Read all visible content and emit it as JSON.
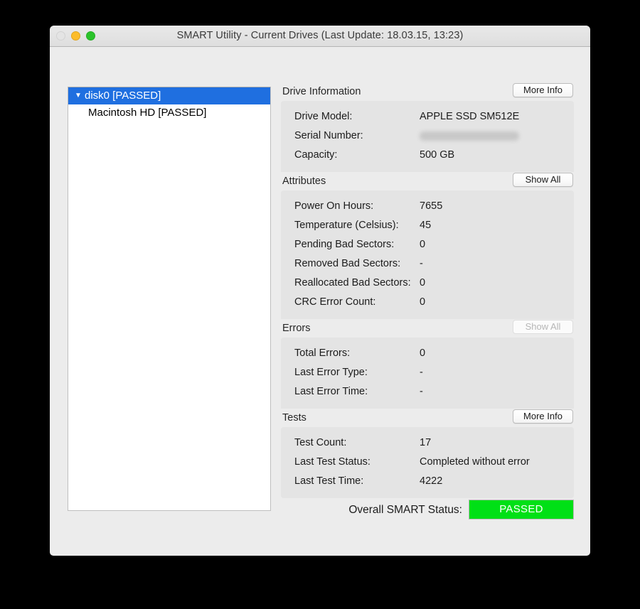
{
  "window": {
    "title": "SMART Utility - Current Drives (Last Update: 18.03.15, 13:23)",
    "traffic_lights": {
      "close": "close-button",
      "minimize": "minimize-button",
      "zoom": "zoom-button"
    }
  },
  "drive_list": {
    "items": [
      {
        "name": "disk0  [PASSED]",
        "selected": true,
        "disclosure": "▼",
        "child": false
      },
      {
        "name": "Macintosh HD  [PASSED]",
        "selected": false,
        "disclosure": "",
        "child": true
      }
    ]
  },
  "sections": [
    {
      "title": "Drive Information",
      "button": {
        "label": "More Info",
        "disabled": false
      },
      "rows": [
        {
          "label": "Drive Model:",
          "value": "APPLE SSD SM512E",
          "redacted": false
        },
        {
          "label": "Serial Number:",
          "value": "",
          "redacted": true
        },
        {
          "label": "Capacity:",
          "value": "500 GB",
          "redacted": false
        }
      ]
    },
    {
      "title": "Attributes",
      "button": {
        "label": "Show All",
        "disabled": false
      },
      "rows": [
        {
          "label": "Power On Hours:",
          "value": "7655",
          "redacted": false
        },
        {
          "label": "Temperature (Celsius):",
          "value": "45",
          "redacted": false
        },
        {
          "label": "Pending Bad Sectors:",
          "value": "0",
          "redacted": false
        },
        {
          "label": "Removed Bad Sectors:",
          "value": "-",
          "redacted": false
        },
        {
          "label": "Reallocated Bad Sectors:",
          "value": "0",
          "redacted": false
        },
        {
          "label": "CRC Error Count:",
          "value": "0",
          "redacted": false
        }
      ]
    },
    {
      "title": "Errors",
      "button": {
        "label": "Show All",
        "disabled": true
      },
      "rows": [
        {
          "label": "Total Errors:",
          "value": "0",
          "redacted": false
        },
        {
          "label": "Last Error Type:",
          "value": "-",
          "redacted": false
        },
        {
          "label": "Last Error Time:",
          "value": "-",
          "redacted": false
        }
      ]
    },
    {
      "title": "Tests",
      "button": {
        "label": "More Info",
        "disabled": false
      },
      "rows": [
        {
          "label": "Test Count:",
          "value": "17",
          "redacted": false
        },
        {
          "label": "Last Test Status:",
          "value": "Completed without error",
          "redacted": false
        },
        {
          "label": "Last Test Time:",
          "value": "4222",
          "redacted": false
        }
      ]
    }
  ],
  "footer": {
    "label": "Overall SMART Status:",
    "status": "PASSED",
    "status_color": "#00e016",
    "status_text_color": "#ffffff"
  },
  "colors": {
    "window_background": "#ececec",
    "panel_background": "#e4e4e4",
    "selection_blue": "#1f6fe0",
    "list_background": "#ffffff"
  }
}
